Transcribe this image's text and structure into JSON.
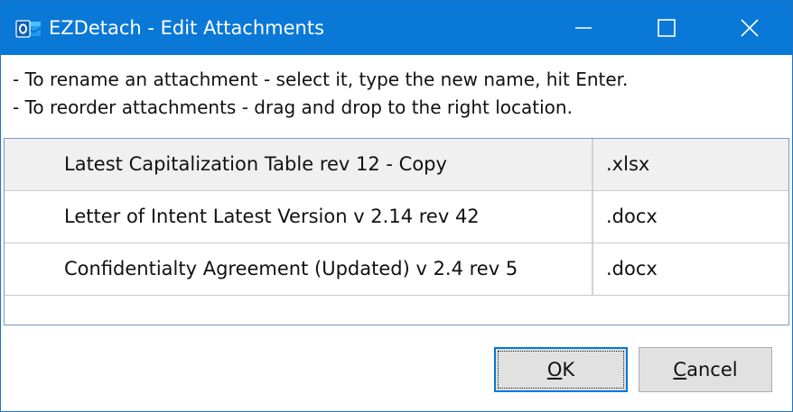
{
  "window": {
    "title": "EZDetach - Edit Attachments",
    "accent_color": "#0a78d7"
  },
  "titlebar_controls": {
    "minimize_icon": "minimize-icon",
    "maximize_icon": "maximize-icon",
    "close_icon": "close-icon"
  },
  "instructions": [
    "- To rename an attachment - select it, type the new name, hit Enter.",
    "- To reorder attachments - drag and drop to the right location."
  ],
  "attachments": [
    {
      "name": "Latest Capitalization Table rev 12 - Copy",
      "ext": ".xlsx",
      "selected": true
    },
    {
      "name": "Letter of Intent Latest Version v 2.14 rev 42",
      "ext": ".docx",
      "selected": false
    },
    {
      "name": "Confidentialty Agreement (Updated) v 2.4 rev 5",
      "ext": ".docx",
      "selected": false
    }
  ],
  "buttons": {
    "ok": {
      "accel": "O",
      "rest": "K"
    },
    "cancel": {
      "accel": "C",
      "rest": "ancel"
    }
  }
}
